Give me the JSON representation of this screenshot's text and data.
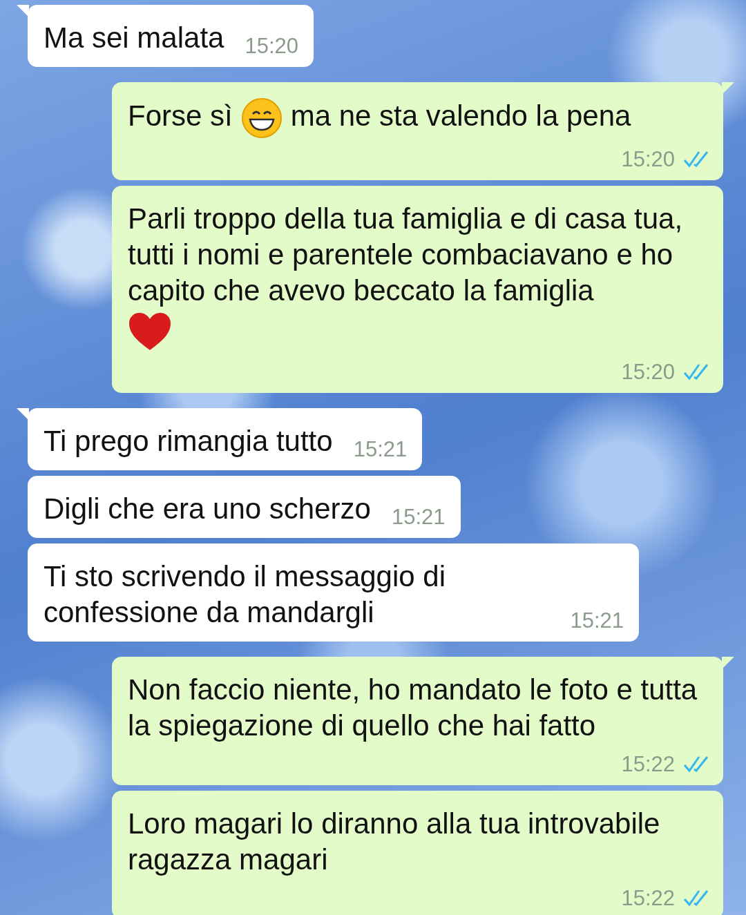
{
  "messages": [
    {
      "kind": "incoming",
      "tail": true,
      "blocks": [
        [
          {
            "kind": "text",
            "text": "Ma sei malata"
          }
        ]
      ],
      "time": "15:20"
    },
    {
      "kind": "outgoing",
      "tail": true,
      "read": true,
      "blocks": [
        [
          {
            "kind": "text",
            "text": "Forse sì"
          },
          {
            "kind": "smile-emoji"
          },
          {
            "kind": "text",
            "text": "ma ne sta valendo la pena"
          }
        ]
      ],
      "time": "15:20"
    },
    {
      "kind": "outgoing",
      "tail": false,
      "read": true,
      "blocks": [
        [
          {
            "kind": "text",
            "text": "Parli troppo della tua famiglia e di casa tua, tutti i nomi e parentele combaciavano e ho capito che avevo beccato la famiglia"
          }
        ],
        [
          {
            "kind": "heart-emoji"
          }
        ]
      ],
      "time": "15:20"
    },
    {
      "kind": "incoming",
      "tail": true,
      "blocks": [
        [
          {
            "kind": "text",
            "text": "Ti prego rimangia tutto"
          }
        ]
      ],
      "time": "15:21"
    },
    {
      "kind": "incoming",
      "tail": false,
      "blocks": [
        [
          {
            "kind": "text",
            "text": "Digli che era uno scherzo"
          }
        ]
      ],
      "time": "15:21"
    },
    {
      "kind": "incoming",
      "tail": false,
      "blocks": [
        [
          {
            "kind": "text",
            "text": "Ti sto scrivendo il messaggio di confessione da mandargli"
          }
        ]
      ],
      "time": "15:21"
    },
    {
      "kind": "outgoing",
      "tail": true,
      "read": true,
      "blocks": [
        [
          {
            "kind": "text",
            "text": "Non faccio niente, ho mandato le foto e tutta la spiegazione di quello che hai fatto"
          }
        ]
      ],
      "time": "15:22"
    },
    {
      "kind": "outgoing",
      "tail": false,
      "read": true,
      "blocks": [
        [
          {
            "kind": "text",
            "text": "Loro magari lo diranno alla tua introvabile ragazza magari"
          }
        ]
      ],
      "time": "15:22"
    }
  ]
}
